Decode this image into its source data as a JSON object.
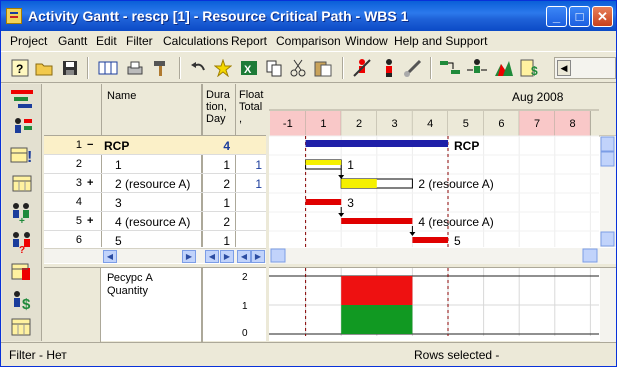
{
  "window": {
    "title": "Activity Gantt - rescp [1] - Resource Critical Path - WBS 1",
    "minimize": "_",
    "maximize": "□",
    "close": "✕"
  },
  "menu": [
    "Project",
    "Gantt",
    "Edit",
    "Filter",
    "Calculations",
    "Report",
    "Comparison",
    "Window",
    "Help and Support"
  ],
  "grid": {
    "headers": {
      "name": "Name",
      "duration": "Dura tion, Day",
      "float": "Float Total ,"
    },
    "rows": [
      {
        "num": "1",
        "expand": "−",
        "name": "RCP",
        "duration": "4",
        "float": "",
        "bold": true
      },
      {
        "num": "2",
        "expand": "",
        "name": "1",
        "duration": "1",
        "float": "1",
        "bold": false
      },
      {
        "num": "3",
        "expand": "+",
        "name": "2 (resource A)",
        "duration": "2",
        "float": "1",
        "bold": false
      },
      {
        "num": "4",
        "expand": "",
        "name": "3",
        "duration": "1",
        "float": "",
        "bold": false
      },
      {
        "num": "5",
        "expand": "+",
        "name": "4 (resource A)",
        "duration": "2",
        "float": "",
        "bold": false
      },
      {
        "num": "6",
        "expand": "",
        "name": "5",
        "duration": "1",
        "float": "",
        "bold": false
      }
    ]
  },
  "gantt": {
    "month_label": "Aug 2008",
    "days": [
      "-1",
      "1",
      "2",
      "3",
      "4",
      "5",
      "6",
      "7",
      "8"
    ],
    "weekend_days": [
      "-1",
      "1",
      "7",
      "8"
    ],
    "bar_labels": [
      "RCP",
      "1",
      "2 (resource A)",
      "3",
      "4 (resource A)",
      "5"
    ],
    "colors": {
      "summary": "#1f1fa8",
      "critical": "#e00000",
      "noncritical": "#f5f000",
      "weekend_header": "#f9c8c8"
    }
  },
  "histogram": {
    "resource_label": "Ресурс A",
    "quantity_label": "Quantity",
    "y_ticks": [
      "2",
      "1",
      "0"
    ],
    "colors": {
      "over": "#ee1111",
      "normal": "#119922"
    }
  },
  "status": {
    "filter": "Filter -  Нет",
    "rows": "Rows selected  -"
  },
  "icons": {
    "toolbar": [
      "help-icon",
      "open-folder-icon",
      "save-icon",
      "columns-icon",
      "print-icon",
      "hammer-icon",
      "undo-icon",
      "star-icon",
      "excel-icon",
      "copy-icon",
      "cut-icon",
      "paste-icon",
      "resource-person-icon",
      "person-icon",
      "link-icon",
      "link-tasks-icon",
      "assign-resource-icon",
      "histogram-icon",
      "cost-icon"
    ],
    "left": [
      "gantt-view-icon",
      "resources-view-icon",
      "calendar-alert-icon",
      "calendar-icon",
      "resource-add-icon",
      "resource-help-icon",
      "calendar-edit-icon",
      "cost-icon",
      "calendar-grid-icon"
    ]
  }
}
